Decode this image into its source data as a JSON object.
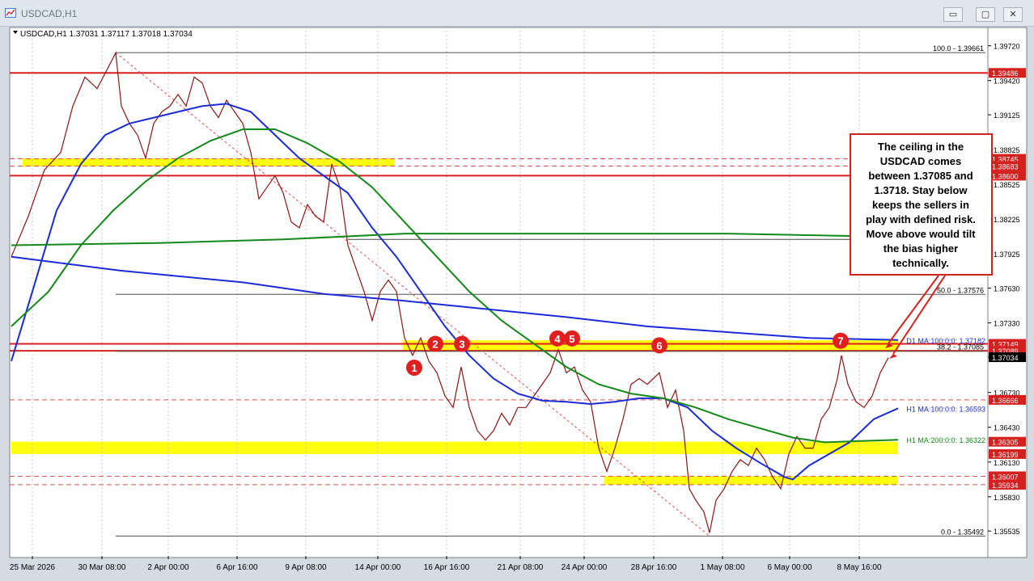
{
  "window": {
    "title": "USDCAD,H1",
    "minimize": "▭",
    "restore": "▢",
    "close": "✕"
  },
  "chart_info": {
    "header": "USDCAD,H1  1.37031 1.37117 1.37018 1.37034"
  },
  "annotation": {
    "lines": [
      "The ceiling in the",
      "USDCAD comes",
      "between 1.37085 and",
      "1.3718.  Stay below",
      "keeps the sellers in",
      "play with defined risk.",
      "Move above would tilt",
      "the bias higher",
      "technically."
    ]
  },
  "chart_data": {
    "type": "line",
    "symbol": "USDCAD",
    "timeframe": "H1",
    "last_price": 1.37034,
    "ylim": [
      1.3532,
      1.3985
    ],
    "y_ticks": [
      "1.39720",
      "1.39420",
      "1.39125",
      "1.38825",
      "1.38525",
      "1.38225",
      "1.37925",
      "1.37630",
      "1.37330",
      "1.37034",
      "1.36730",
      "1.36430",
      "1.36130",
      "1.35830",
      "1.35535"
    ],
    "x_ticks": [
      "25 Mar 2026",
      "30 Mar 08:00",
      "2 Apr 00:00",
      "6 Apr 16:00",
      "9 Apr 08:00",
      "14 Apr 00:00",
      "16 Apr 16:00",
      "21 Apr 08:00",
      "24 Apr 00:00",
      "28 Apr 16:00",
      "1 May 08:00",
      "6 May 00:00",
      "8 May 16:00"
    ],
    "x_range": [
      0,
      1110
    ],
    "price_labels": [
      {
        "text": "1.39486",
        "color": "#d62020"
      },
      {
        "text": "1.38745",
        "color": "#d62020"
      },
      {
        "text": "1.38683",
        "color": "#d62020"
      },
      {
        "text": "1.38600",
        "color": "#d62020"
      },
      {
        "text": "1.37149",
        "color": "#d62020"
      },
      {
        "text": "1.37089",
        "color": "#d62020"
      },
      {
        "text": "1.37034",
        "color": "#000000"
      },
      {
        "text": "1.36666",
        "color": "#d62020"
      },
      {
        "text": "1.36305",
        "color": "#d62020"
      },
      {
        "text": "1.36199",
        "color": "#d62020"
      },
      {
        "text": "1.36007",
        "color": "#d62020"
      },
      {
        "text": "1.35934",
        "color": "#d62020"
      }
    ],
    "fib_labels": [
      {
        "text": "100.0 - 1.39661",
        "price": 1.39661
      },
      {
        "text": "50.0 - 1.37576",
        "price": 1.37576
      },
      {
        "text": "38.2 - 1.37085",
        "price": 1.37085
      },
      {
        "text": "0.0 - 1.35492",
        "price": 1.35492
      }
    ],
    "ma_labels": [
      {
        "text": "D1 MA:100:0:0: 1.37182",
        "color": "#1b2bd6"
      },
      {
        "text": "H1 MA:100:0:0: 1.36593",
        "color": "#1b2bd6"
      },
      {
        "text": "H1 MA:200:0:0: 1.36322",
        "color": "#14881a"
      }
    ],
    "red_levels": [
      1.39486,
      1.386,
      1.37149,
      1.37089
    ],
    "dashed_levels": [
      1.38745,
      1.38683,
      1.36666,
      1.36007,
      1.35934
    ],
    "gray_levels": [
      1.3805
    ],
    "zones": [
      {
        "from": 1.38683,
        "to": 1.38745,
        "x0": 14,
        "x1": 480
      },
      {
        "from": 1.37085,
        "to": 1.3718,
        "x0": 490,
        "x1": 1110
      },
      {
        "from": 1.36199,
        "to": 1.36305,
        "x0": 0,
        "x1": 1110
      },
      {
        "from": 1.35934,
        "to": 1.36007,
        "x0": 742,
        "x1": 1110
      }
    ],
    "markers": [
      {
        "label": "1",
        "x": 512,
        "price": 1.36944
      },
      {
        "label": "2",
        "x": 538,
        "price": 1.37149
      },
      {
        "label": "3",
        "x": 571,
        "price": 1.37149
      },
      {
        "label": "4",
        "x": 689,
        "price": 1.37196
      },
      {
        "label": "5",
        "x": 707,
        "price": 1.37196
      },
      {
        "label": "6",
        "x": 815,
        "price": 1.37136
      },
      {
        "label": "7",
        "x": 1039,
        "price": 1.37176
      }
    ],
    "series": [
      {
        "name": "Price",
        "color": "#8a1616",
        "points": [
          [
            14,
            1.379
          ],
          [
            35,
            1.3825
          ],
          [
            55,
            1.3865
          ],
          [
            75,
            1.388
          ],
          [
            90,
            1.392
          ],
          [
            105,
            1.3945
          ],
          [
            120,
            1.3935
          ],
          [
            135,
            1.3955
          ],
          [
            143,
            1.3966
          ],
          [
            150,
            1.392
          ],
          [
            160,
            1.3905
          ],
          [
            170,
            1.3895
          ],
          [
            180,
            1.3875
          ],
          [
            190,
            1.3905
          ],
          [
            200,
            1.3915
          ],
          [
            210,
            1.392
          ],
          [
            220,
            1.393
          ],
          [
            230,
            1.392
          ],
          [
            240,
            1.3945
          ],
          [
            250,
            1.394
          ],
          [
            260,
            1.392
          ],
          [
            270,
            1.391
          ],
          [
            280,
            1.3925
          ],
          [
            290,
            1.3915
          ],
          [
            300,
            1.3905
          ],
          [
            310,
            1.388
          ],
          [
            320,
            1.384
          ],
          [
            330,
            1.385
          ],
          [
            340,
            1.386
          ],
          [
            350,
            1.3845
          ],
          [
            360,
            1.382
          ],
          [
            370,
            1.3815
          ],
          [
            380,
            1.3835
          ],
          [
            390,
            1.3825
          ],
          [
            400,
            1.382
          ],
          [
            410,
            1.387
          ],
          [
            420,
            1.385
          ],
          [
            430,
            1.38
          ],
          [
            440,
            1.378
          ],
          [
            450,
            1.376
          ],
          [
            460,
            1.3735
          ],
          [
            470,
            1.376
          ],
          [
            480,
            1.377
          ],
          [
            490,
            1.376
          ],
          [
            500,
            1.372
          ],
          [
            510,
            1.3705
          ],
          [
            520,
            1.372
          ],
          [
            530,
            1.37
          ],
          [
            540,
            1.369
          ],
          [
            550,
            1.367
          ],
          [
            560,
            1.366
          ],
          [
            570,
            1.3695
          ],
          [
            580,
            1.366
          ],
          [
            590,
            1.364
          ],
          [
            600,
            1.3632
          ],
          [
            610,
            1.364
          ],
          [
            620,
            1.3655
          ],
          [
            630,
            1.3645
          ],
          [
            640,
            1.366
          ],
          [
            650,
            1.366
          ],
          [
            660,
            1.367
          ],
          [
            670,
            1.368
          ],
          [
            680,
            1.369
          ],
          [
            690,
            1.371
          ],
          [
            700,
            1.369
          ],
          [
            710,
            1.3695
          ],
          [
            720,
            1.3675
          ],
          [
            730,
            1.3665
          ],
          [
            740,
            1.3625
          ],
          [
            750,
            1.3605
          ],
          [
            760,
            1.3625
          ],
          [
            770,
            1.365
          ],
          [
            780,
            1.368
          ],
          [
            790,
            1.3685
          ],
          [
            800,
            1.368
          ],
          [
            815,
            1.369
          ],
          [
            825,
            1.366
          ],
          [
            835,
            1.3675
          ],
          [
            845,
            1.364
          ],
          [
            852,
            1.359
          ],
          [
            860,
            1.358
          ],
          [
            870,
            1.357
          ],
          [
            877,
            1.3552
          ],
          [
            885,
            1.358
          ],
          [
            895,
            1.359
          ],
          [
            905,
            1.3605
          ],
          [
            915,
            1.3615
          ],
          [
            925,
            1.361
          ],
          [
            935,
            1.3625
          ],
          [
            945,
            1.3615
          ],
          [
            955,
            1.36
          ],
          [
            965,
            1.359
          ],
          [
            975,
            1.362
          ],
          [
            985,
            1.3635
          ],
          [
            995,
            1.3625
          ],
          [
            1005,
            1.3625
          ],
          [
            1015,
            1.365
          ],
          [
            1025,
            1.366
          ],
          [
            1035,
            1.3685
          ],
          [
            1040,
            1.3705
          ],
          [
            1048,
            1.368
          ],
          [
            1058,
            1.3665
          ],
          [
            1068,
            1.366
          ],
          [
            1078,
            1.367
          ],
          [
            1088,
            1.369
          ],
          [
            1098,
            1.3703
          ]
        ]
      },
      {
        "name": "H1 MA 100",
        "color": "#1b2bd6",
        "points": [
          [
            14,
            1.37
          ],
          [
            40,
            1.376
          ],
          [
            70,
            1.383
          ],
          [
            100,
            1.387
          ],
          [
            130,
            1.3895
          ],
          [
            160,
            1.3905
          ],
          [
            190,
            1.391
          ],
          [
            220,
            1.3915
          ],
          [
            250,
            1.392
          ],
          [
            280,
            1.3922
          ],
          [
            310,
            1.3915
          ],
          [
            340,
            1.3895
          ],
          [
            370,
            1.3875
          ],
          [
            400,
            1.386
          ],
          [
            430,
            1.3845
          ],
          [
            460,
            1.3815
          ],
          [
            490,
            1.379
          ],
          [
            520,
            1.376
          ],
          [
            550,
            1.373
          ],
          [
            580,
            1.3705
          ],
          [
            610,
            1.3685
          ],
          [
            640,
            1.3672
          ],
          [
            670,
            1.3666
          ],
          [
            700,
            1.3665
          ],
          [
            730,
            1.3663
          ],
          [
            760,
            1.3665
          ],
          [
            790,
            1.3668
          ],
          [
            820,
            1.3668
          ],
          [
            850,
            1.366
          ],
          [
            880,
            1.364
          ],
          [
            910,
            1.3625
          ],
          [
            940,
            1.3612
          ],
          [
            970,
            1.36
          ],
          [
            980,
            1.3598
          ],
          [
            1000,
            1.361
          ],
          [
            1020,
            1.3618
          ],
          [
            1050,
            1.363
          ],
          [
            1080,
            1.365
          ],
          [
            1110,
            1.36593
          ]
        ]
      },
      {
        "name": "H1 MA 200",
        "color": "#14881a",
        "points": [
          [
            14,
            1.373
          ],
          [
            60,
            1.376
          ],
          [
            100,
            1.38
          ],
          [
            140,
            1.383
          ],
          [
            180,
            1.3855
          ],
          [
            220,
            1.3875
          ],
          [
            260,
            1.389
          ],
          [
            300,
            1.39
          ],
          [
            340,
            1.39
          ],
          [
            380,
            1.3888
          ],
          [
            420,
            1.3872
          ],
          [
            460,
            1.385
          ],
          [
            500,
            1.382
          ],
          [
            540,
            1.379
          ],
          [
            580,
            1.376
          ],
          [
            620,
            1.3735
          ],
          [
            660,
            1.3715
          ],
          [
            700,
            1.3695
          ],
          [
            740,
            1.368
          ],
          [
            780,
            1.3672
          ],
          [
            820,
            1.3668
          ],
          [
            860,
            1.366
          ],
          [
            900,
            1.365
          ],
          [
            940,
            1.3642
          ],
          [
            980,
            1.3634
          ],
          [
            1020,
            1.363
          ],
          [
            1060,
            1.3631
          ],
          [
            1110,
            1.36322
          ]
        ]
      },
      {
        "name": "D1 MA 100",
        "color": "#1b2bd6",
        "points": [
          [
            14,
            1.379
          ],
          [
            150,
            1.3778
          ],
          [
            300,
            1.3768
          ],
          [
            400,
            1.3758
          ],
          [
            500,
            1.3752
          ],
          [
            600,
            1.3745
          ],
          [
            700,
            1.3738
          ],
          [
            800,
            1.373
          ],
          [
            900,
            1.3725
          ],
          [
            1000,
            1.372
          ],
          [
            1110,
            1.37182
          ]
        ]
      },
      {
        "name": "D1 MA 200",
        "color": "#14881a",
        "points": [
          [
            14,
            1.38
          ],
          [
            200,
            1.3802
          ],
          [
            350,
            1.3805
          ],
          [
            500,
            1.381
          ],
          [
            700,
            1.381
          ],
          [
            900,
            1.381
          ],
          [
            1050,
            1.3808
          ]
        ]
      }
    ],
    "fib_x": [
      143,
      1110
    ],
    "fib_trend": [
      [
        143,
        1.39661
      ],
      [
        877,
        1.35492
      ]
    ]
  }
}
